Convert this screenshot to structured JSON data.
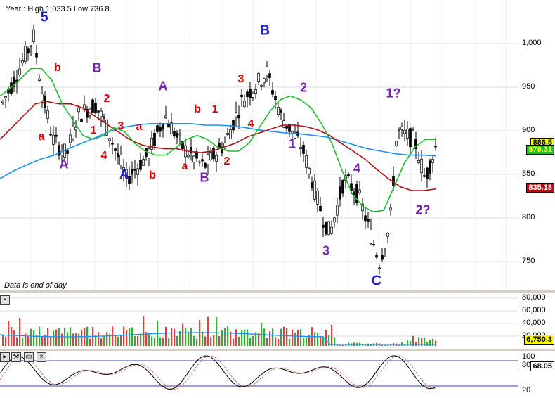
{
  "header": {
    "text": "Year : High 1,033.5 Low 736.8"
  },
  "data_note": "Data is end of day",
  "colors": {
    "up": "#000000",
    "down": "#000000",
    "ma_green": "#22bb33",
    "ma_red": "#b01010",
    "ma_blue": "#1e90ff"
  },
  "price_axis": {
    "ticks": [
      "1,000",
      "950",
      "900",
      "850",
      "800",
      "750"
    ]
  },
  "price_tags": [
    {
      "label": "886.5",
      "bg": "#ffff00",
      "fg": "#000000"
    },
    {
      "label": "879.31",
      "bg": "#22bb33",
      "fg": "#ffff00"
    },
    {
      "label": "835.18",
      "bg": "#b01010",
      "fg": "#ffffff"
    }
  ],
  "volume_axis": {
    "ticks": [
      "80,000",
      "60,000",
      "40,000",
      "20,000"
    ],
    "tag": "6,750.3"
  },
  "osc_axis": {
    "ticks": [
      "100",
      "80",
      "20"
    ],
    "tag": "68.05"
  },
  "wave_labels": [
    {
      "text": "5",
      "style": "blue"
    },
    {
      "text": "b",
      "style": "red"
    },
    {
      "text": "B",
      "style": "purple"
    },
    {
      "text": "2",
      "style": "red"
    },
    {
      "text": "a",
      "style": "red"
    },
    {
      "text": "1",
      "style": "red"
    },
    {
      "text": "A",
      "style": "purple"
    },
    {
      "text": "3",
      "style": "red"
    },
    {
      "text": "4",
      "style": "red"
    },
    {
      "text": "a",
      "style": "red"
    },
    {
      "text": "A",
      "style": "blue"
    },
    {
      "text": "b",
      "style": "red"
    },
    {
      "text": "A",
      "style": "purple"
    },
    {
      "text": "b",
      "style": "red"
    },
    {
      "text": "1",
      "style": "red"
    },
    {
      "text": "a",
      "style": "red"
    },
    {
      "text": "B",
      "style": "purple"
    },
    {
      "text": "2",
      "style": "red"
    },
    {
      "text": "3",
      "style": "red"
    },
    {
      "text": "4",
      "style": "red"
    },
    {
      "text": "B",
      "style": "blue"
    },
    {
      "text": "2",
      "style": "purple"
    },
    {
      "text": "1",
      "style": "purple"
    },
    {
      "text": "3",
      "style": "purple"
    },
    {
      "text": "4",
      "style": "purple"
    },
    {
      "text": "C",
      "style": "blue"
    },
    {
      "text": "1?",
      "style": "purple"
    },
    {
      "text": "2?",
      "style": "purple"
    }
  ],
  "chart_data": {
    "type": "candlestick",
    "ylim": [
      720,
      1050
    ],
    "ma": {
      "green": [
        955,
        965,
        977,
        990,
        990,
        975,
        945,
        925,
        905,
        900,
        905,
        915,
        910,
        895,
        885,
        880,
        880,
        890,
        900,
        905,
        900,
        890,
        885,
        885,
        895,
        915,
        935,
        950,
        955,
        950,
        940,
        920,
        895,
        860,
        830,
        815,
        808,
        810,
        840,
        870,
        890,
        900,
        900
      ],
      "red": [
        900,
        915,
        930,
        945,
        948,
        945,
        945,
        940,
        930,
        920,
        910,
        900,
        893,
        890,
        888,
        888,
        885,
        883,
        885,
        890,
        895,
        903,
        908,
        913,
        918,
        918,
        916,
        912,
        905,
        895,
        885,
        875,
        862,
        850,
        840,
        835,
        835,
        837
      ],
      "blue": [
        850,
        860,
        868,
        875,
        880,
        888,
        895,
        902,
        910,
        915,
        918,
        920,
        920,
        920,
        920,
        918,
        918,
        917,
        915,
        912,
        910,
        908,
        907,
        905,
        903,
        898,
        893,
        888,
        885,
        882,
        880,
        880,
        879
      ]
    },
    "volume": {
      "ylim": [
        0,
        90000
      ]
    },
    "oscillator": {
      "ylim": [
        0,
        100
      ],
      "levels": [
        80,
        20
      ]
    }
  }
}
